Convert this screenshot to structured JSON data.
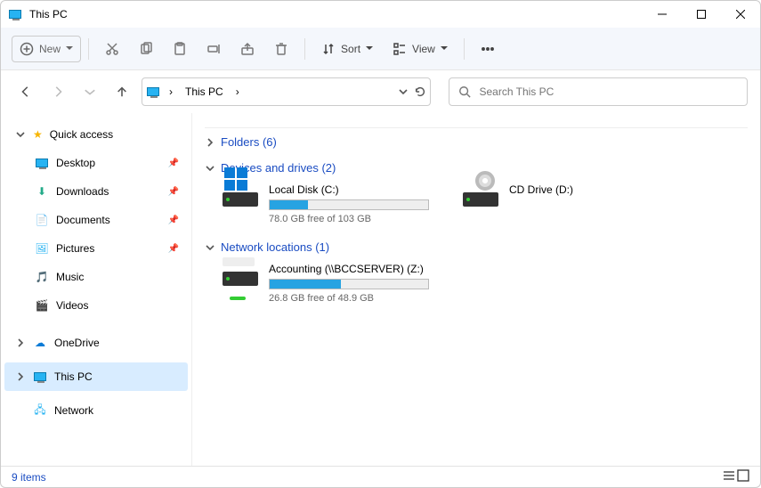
{
  "window": {
    "title": "This PC"
  },
  "toolbar": {
    "new": "New",
    "sort": "Sort",
    "view": "View"
  },
  "nav": {
    "location": "This PC",
    "search_placeholder": "Search This PC"
  },
  "sidebar": {
    "quick_access": "Quick access",
    "items": [
      {
        "label": "Desktop"
      },
      {
        "label": "Downloads"
      },
      {
        "label": "Documents"
      },
      {
        "label": "Pictures"
      },
      {
        "label": "Music"
      },
      {
        "label": "Videos"
      }
    ],
    "onedrive": "OneDrive",
    "this_pc": "This PC",
    "network": "Network"
  },
  "content": {
    "folders": {
      "label": "Folders",
      "count": 6,
      "display": "Folders (6)"
    },
    "devices": {
      "label": "Devices and drives",
      "count": 2,
      "display": "Devices and drives (2)",
      "items": [
        {
          "name": "Local Disk (C:)",
          "free": "78.0 GB free of 103 GB",
          "fill_pct": 24
        },
        {
          "name": "CD Drive (D:)"
        }
      ]
    },
    "network": {
      "label": "Network locations",
      "count": 1,
      "display": "Network locations (1)",
      "items": [
        {
          "name": "Accounting (\\\\BCCSERVER) (Z:)",
          "free": "26.8 GB free of 48.9 GB",
          "fill_pct": 45
        }
      ]
    }
  },
  "status": {
    "text": "9 items"
  }
}
